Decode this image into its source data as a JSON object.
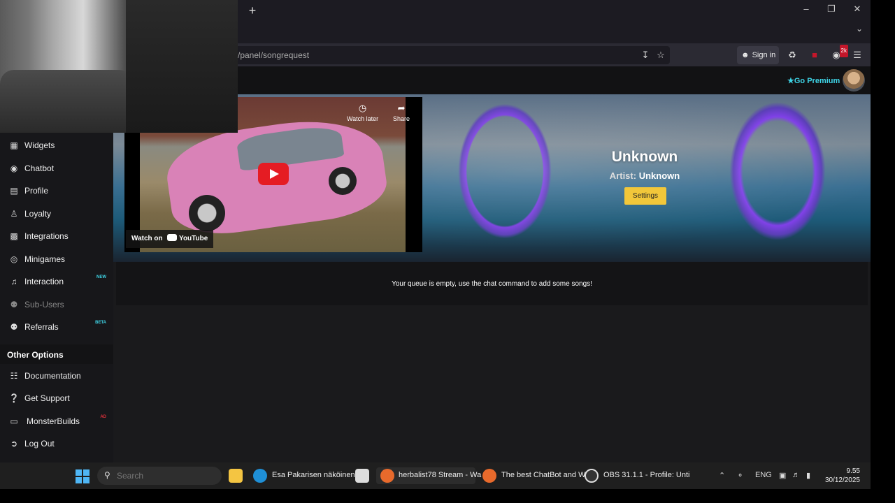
{
  "browser": {
    "url": "/panel/songrequest",
    "sign_in": "Sign in",
    "new_tab": "+",
    "minimize": "–",
    "restore": "❐",
    "close": "✕",
    "extension_badge": "2k"
  },
  "header": {
    "premium": "Go Premium"
  },
  "sidebar": {
    "items": [
      {
        "label": "Widgets",
        "icon": "grid-icon"
      },
      {
        "label": "Chatbot",
        "icon": "robot-icon"
      },
      {
        "label": "Profile",
        "icon": "id-card-icon"
      },
      {
        "label": "Loyalty",
        "icon": "trophy-icon"
      },
      {
        "label": "Integrations",
        "icon": "puzzle-icon"
      },
      {
        "label": "Minigames",
        "icon": "gamepad-icon"
      },
      {
        "label": "Interaction",
        "icon": "music-icon",
        "tag": "NEW"
      },
      {
        "label": "Sub-Users",
        "icon": "users-icon"
      },
      {
        "label": "Referrals",
        "icon": "users-icon",
        "tag": "BETA"
      }
    ],
    "section_title": "Other Options",
    "other": [
      {
        "label": "Documentation",
        "icon": "book-icon"
      },
      {
        "label": "Get Support",
        "icon": "help-icon"
      },
      {
        "label": "MonsterBuilds",
        "icon": "laptop-icon",
        "tag": "AD"
      },
      {
        "label": "Log Out",
        "icon": "logout-icon"
      }
    ]
  },
  "video": {
    "watch_later": "Watch later",
    "share": "Share",
    "watch_on": "Watch on",
    "youtube": "YouTube"
  },
  "song": {
    "title": "Unknown",
    "artist_label": "Artist:",
    "artist": "Unknown",
    "settings_button": "Settings"
  },
  "queue": {
    "empty_message": "Your queue is empty, use the chat command to add some songs!"
  },
  "taskbar": {
    "search_placeholder": "Search",
    "apps": [
      {
        "label": "Esa Pakarisen näköinen"
      },
      {
        "label": "herbalist78 Stream - Wa"
      },
      {
        "label": "The best ChatBot and W"
      },
      {
        "label": "OBS 31.1.1 - Profile: Unti"
      }
    ],
    "language": "ENG",
    "time": "9.55",
    "date": "30/12/2025"
  },
  "colors": {
    "accent_cyan": "#3fd6e8",
    "settings_yellow": "#f2c73a",
    "youtube_red": "#e51c23"
  }
}
